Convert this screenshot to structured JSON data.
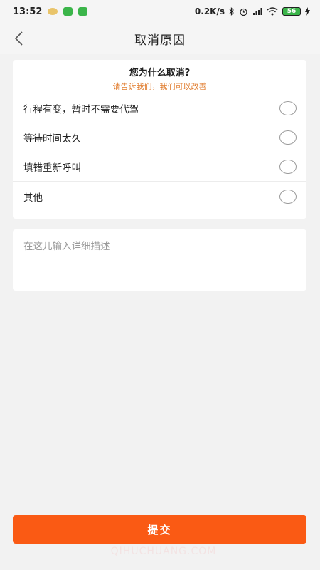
{
  "status_bar": {
    "time": "13:52",
    "net_speed": "0.2K/s",
    "battery": "56",
    "bluetooth_icon": "bluetooth-icon",
    "alarm_icon": "alarm-icon",
    "signal_icon": "signal-icon",
    "wifi_icon": "wifi-icon"
  },
  "navbar": {
    "title": "取消原因",
    "back_icon": "chevron-left-icon"
  },
  "reasons": {
    "question": "您为什么取消?",
    "subtitle": "请告诉我们，我们可以改善",
    "options": [
      {
        "label": "行程有变，暂时不需要代驾",
        "selected": false
      },
      {
        "label": "等待时间太久",
        "selected": false
      },
      {
        "label": "填错重新呼叫",
        "selected": false
      },
      {
        "label": "其他",
        "selected": false
      }
    ]
  },
  "description": {
    "placeholder": "在这儿输入详细描述",
    "value": ""
  },
  "submit": {
    "label": "提交"
  },
  "watermark": "QIHUCHUANG.COM",
  "colors": {
    "accent": "#fa5a14",
    "subtitle": "#e07a2a",
    "background": "#f2f2f2"
  }
}
